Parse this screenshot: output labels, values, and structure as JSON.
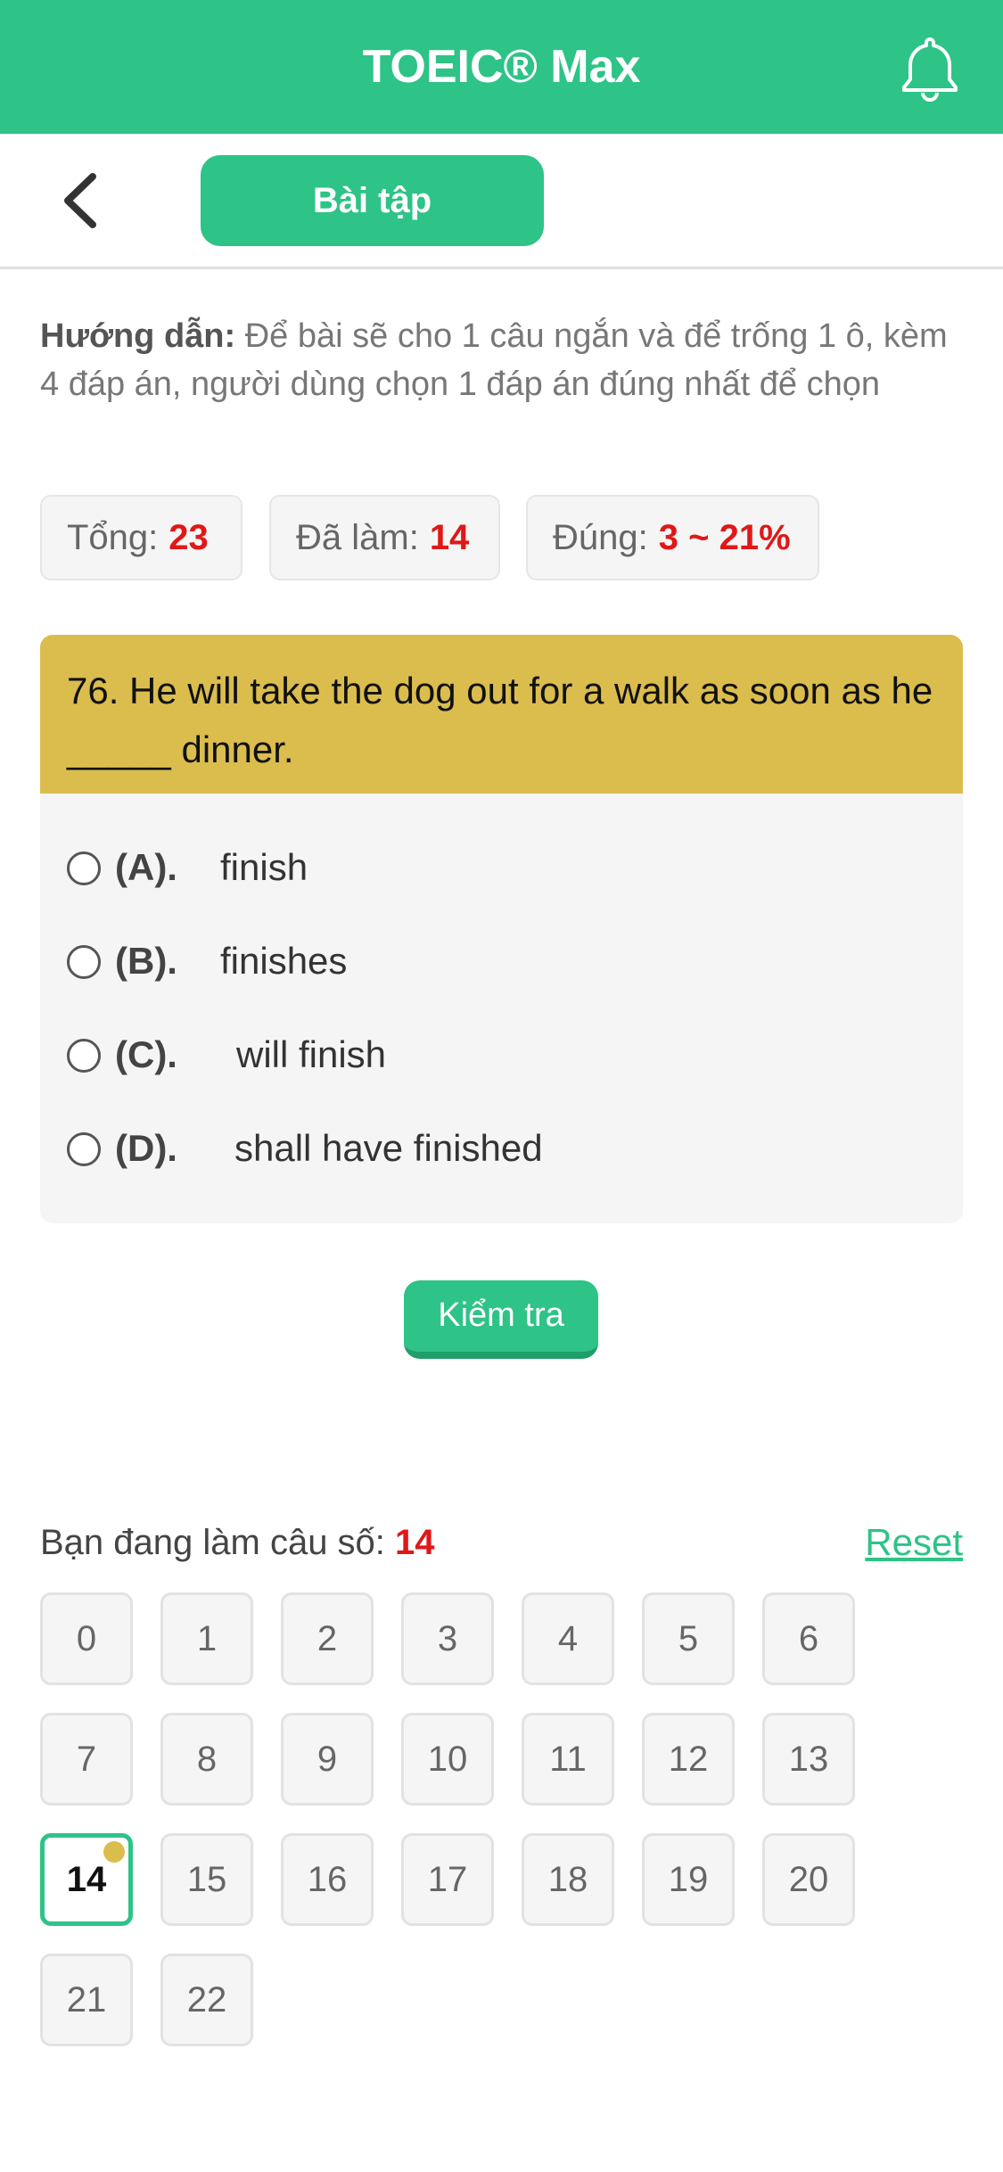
{
  "header": {
    "title": "TOEIC® Max",
    "bell_icon": "bell-icon"
  },
  "subbar": {
    "back_icon": "chevron-left-icon",
    "tab_label": "Bài tập"
  },
  "guide": {
    "label": "Hướng dẫn:",
    "text": " Để bài sẽ cho 1 câu ngắn và để trống 1 ô, kèm 4 đáp án, người dùng chọn 1 đáp án đúng nhất để chọn"
  },
  "stats": {
    "total_label": "Tổng:",
    "total_value": "23",
    "done_label": "Đã làm:",
    "done_value": "14",
    "correct_label": "Đúng:",
    "correct_value": "3 ~ 21%"
  },
  "question": {
    "text": "76. He will take the dog out for a walk as soon as he _____ dinner.",
    "options": [
      {
        "label": "(A).",
        "text": "finish"
      },
      {
        "label": "(B).",
        "text": "finishes"
      },
      {
        "label": "(C).",
        "text": "will finish"
      },
      {
        "label": "(D).",
        "text": "shall have finished"
      }
    ]
  },
  "check_button": "Kiểm tra",
  "progress": {
    "current_label": "Bạn đang làm câu số:",
    "current_value": "14",
    "reset_label": "Reset"
  },
  "questions_grid": [
    "0",
    "1",
    "2",
    "3",
    "4",
    "5",
    "6",
    "7",
    "8",
    "9",
    "10",
    "11",
    "12",
    "13",
    "14",
    "15",
    "16",
    "17",
    "18",
    "19",
    "20",
    "21",
    "22"
  ],
  "colors": {
    "primary": "#2ec387",
    "question_header": "#dbbd4e",
    "highlight": "#e01818"
  }
}
